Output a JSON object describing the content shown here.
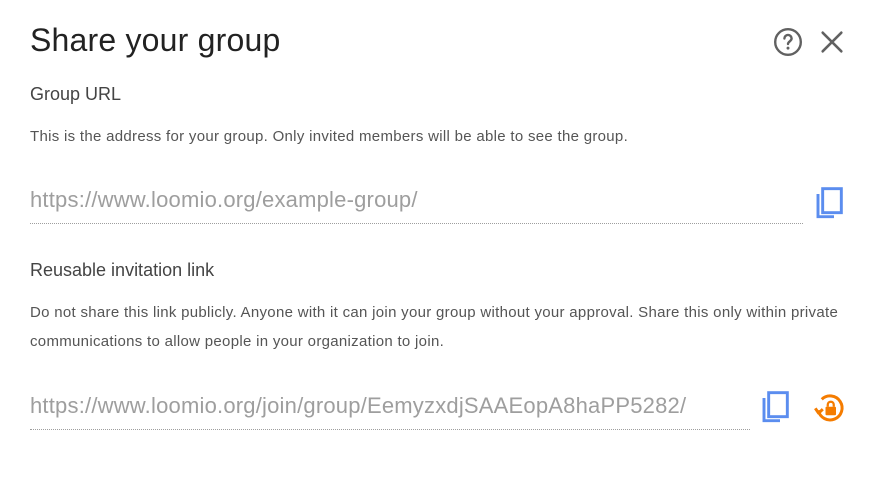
{
  "dialog": {
    "title": "Share your group"
  },
  "icons": {
    "help": "help-circle-outline",
    "close": "close",
    "copy": "content-copy",
    "reset": "lock-reset"
  },
  "colors": {
    "copy_icon": "#5b8def",
    "reset_icon": "#f57c00",
    "header_icon": "#616161"
  },
  "group_url": {
    "label": "Group URL",
    "description": "This is the address for your group. Only invited members will be able to see the group.",
    "value": "https://www.loomio.org/example-group/"
  },
  "invitation_link": {
    "label": "Reusable invitation link",
    "description": "Do not share this link publicly. Anyone with it can join your group without your approval. Share this only within private communications to allow people in your organization to join.",
    "value": "https://www.loomio.org/join/group/EemyzxdjSAAEopA8haPP5282/"
  }
}
